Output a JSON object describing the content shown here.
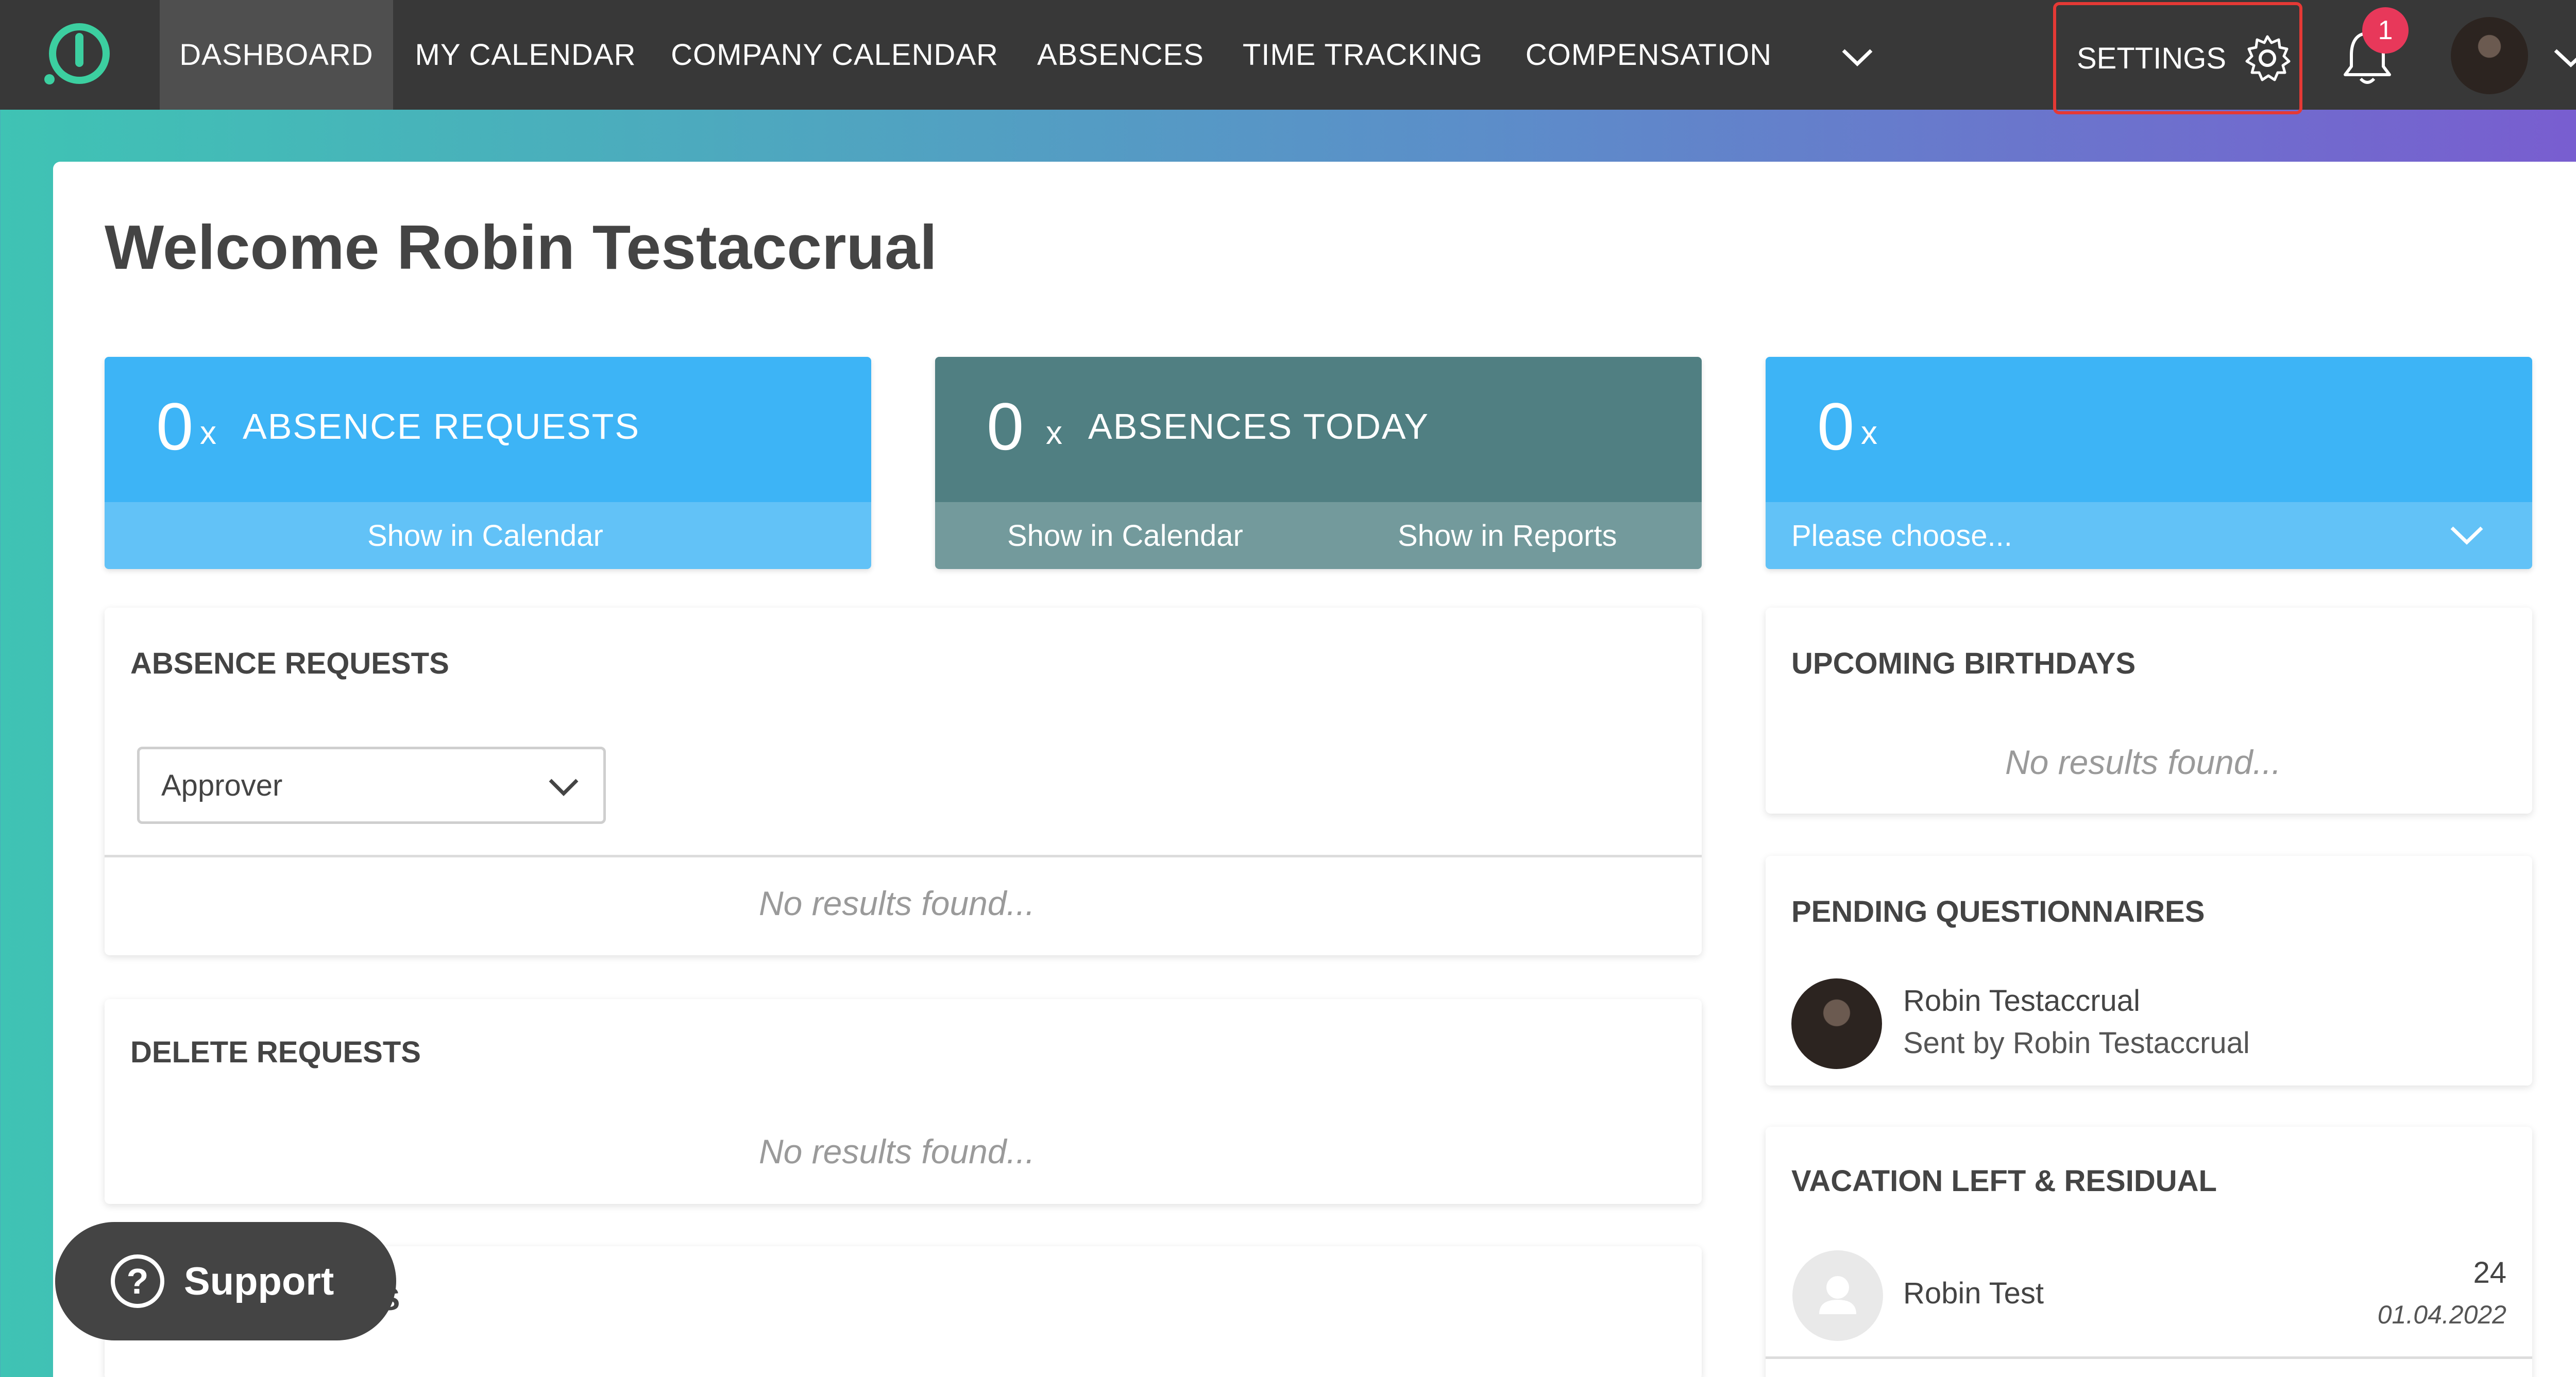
{
  "nav": {
    "items": [
      {
        "label": "DASHBOARD",
        "active": true
      },
      {
        "label": "MY CALENDAR"
      },
      {
        "label": "COMPANY CALENDAR"
      },
      {
        "label": "ABSENCES"
      },
      {
        "label": "TIME TRACKING"
      },
      {
        "label": "COMPENSATION"
      }
    ],
    "settings_label": "SETTINGS",
    "notification_count": "1",
    "icons": {
      "logo": "logo-icon",
      "more": "chevron-down-icon",
      "settings": "gear-icon",
      "notifications": "bell-icon",
      "account": "chevron-down-icon"
    }
  },
  "welcome": "Welcome Robin Testaccrual",
  "stats": {
    "absence_requests": {
      "count": "0",
      "x": "x",
      "label": "ABSENCE REQUESTS",
      "link": "Show in Calendar"
    },
    "absences_today": {
      "count": "0",
      "x": "x",
      "label": "ABSENCES TODAY",
      "link_calendar": "Show in Calendar",
      "link_reports": "Show in Reports"
    },
    "custom": {
      "count": "0",
      "x": "x",
      "select_placeholder": "Please choose..."
    }
  },
  "absence_requests_card": {
    "title": "ABSENCE REQUESTS",
    "filter_value": "Approver",
    "empty": "No results found..."
  },
  "delete_requests_card": {
    "title": "DELETE REQUESTS",
    "empty": "No results found..."
  },
  "third_card_partial": "S",
  "upcoming_birthdays": {
    "title": "UPCOMING BIRTHDAYS",
    "empty": "No results found..."
  },
  "pending_questionnaires": {
    "title": "PENDING QUESTIONNAIRES",
    "items": [
      {
        "name": "Robin Testaccrual",
        "sub": "Sent by Robin Testaccrual"
      }
    ]
  },
  "vacation_left": {
    "title": "VACATION LEFT & RESIDUAL",
    "items": [
      {
        "name": "Robin Test",
        "days": "24",
        "date": "01.04.2022"
      }
    ]
  },
  "support": {
    "label": "Support",
    "icon": "help-circle-icon"
  },
  "colors": {
    "navbar": "#383838",
    "stat_blue": "#3db4f6",
    "stat_teal": "#507f82",
    "badge": "#e8385a",
    "settings_highlight": "#e53935"
  }
}
